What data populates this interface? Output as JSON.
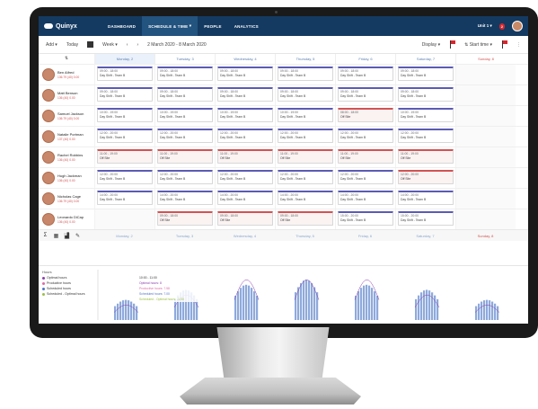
{
  "brand": {
    "name": "Quinyx"
  },
  "nav": [
    {
      "label": "DASHBOARD",
      "active": false
    },
    {
      "label": "SCHEDULE & TIME",
      "active": true
    },
    {
      "label": "PEOPLE",
      "active": false
    },
    {
      "label": "ANALYTICS",
      "active": false
    }
  ],
  "topbar": {
    "unit": "Unit 1",
    "notifications": "2"
  },
  "toolbar": {
    "add": "Add",
    "today": "Today",
    "period": "Week",
    "date_range": "2 March 2020 - 8 March 2020",
    "display": "Display",
    "flag_count": "2",
    "sort": "Start time",
    "alerts": "15"
  },
  "days": [
    {
      "label": "Monday, 2",
      "today": true,
      "sunday": false
    },
    {
      "label": "Tuesday, 3",
      "today": false,
      "sunday": false
    },
    {
      "label": "Wednesday, 4",
      "today": false,
      "sunday": false
    },
    {
      "label": "Thursday, 5",
      "today": false,
      "sunday": false
    },
    {
      "label": "Friday, 6",
      "today": false,
      "sunday": false
    },
    {
      "label": "Saturday, 7",
      "today": false,
      "sunday": false
    },
    {
      "label": "Sunday, 8",
      "today": false,
      "sunday": true
    }
  ],
  "employees": [
    {
      "name": "Ben Alfred",
      "hours": "136.79 (40) 0.00",
      "shifts": [
        [
          "09:00 - 18:00",
          "Day Shift - Team B"
        ],
        [
          "09:00 - 18:00",
          "Day Shift - Team B"
        ],
        [
          "09:00 - 18:00",
          "Day Shift - Team B"
        ],
        [
          "09:00 - 18:00",
          "Day Shift - Team B"
        ],
        [
          "09:00 - 18:00",
          "Day Shift - Team B"
        ],
        [
          "09:00 - 18:00",
          "Day Shift - Team B"
        ],
        null
      ]
    },
    {
      "name": "Matt Benson",
      "hours": "136 (40) 0.00",
      "shifts": [
        [
          "09:00 - 18:00",
          "Day Shift - Team B"
        ],
        [
          "09:00 - 18:00",
          "Day Shift - Team B"
        ],
        [
          "09:00 - 18:00",
          "Day Shift - Team B"
        ],
        [
          "09:00 - 18:00",
          "Day Shift - Team B"
        ],
        [
          "09:00 - 18:00",
          "Day Shift - Team B"
        ],
        [
          "09:00 - 18:00",
          "Day Shift - Team B"
        ],
        null
      ]
    },
    {
      "name": "Samuel Jackson",
      "hours": "136.79 (40) 0.00",
      "shifts": [
        [
          "10:00 - 19:00",
          "Day Shift - Team B"
        ],
        [
          "10:00 - 19:00",
          "Day Shift - Team B"
        ],
        [
          "10:00 - 19:00",
          "Day Shift - Team B"
        ],
        [
          "10:00 - 19:00",
          "Day Shift - Team B"
        ],
        [
          "08:00 - 18:00",
          "Off Site",
          "off"
        ],
        [
          "10:00 - 19:00",
          "Day Shift - Team B"
        ],
        null
      ]
    },
    {
      "name": "Natalie Portman",
      "hours": "137 (40) 0.00",
      "shifts": [
        [
          "12:00 - 20:00",
          "Day Shift - Team B"
        ],
        [
          "12:00 - 20:00",
          "Day Shift - Team B"
        ],
        [
          "12:00 - 20:00",
          "Day Shift - Team B"
        ],
        [
          "12:00 - 20:00",
          "Day Shift - Team B"
        ],
        [
          "12:00 - 20:00",
          "Day Shift - Team B"
        ],
        [
          "12:00 - 20:00",
          "Day Shift - Team B"
        ],
        null
      ]
    },
    {
      "name": "Rachel Robbins",
      "hours": "136 (40) 0.00",
      "shifts": [
        [
          "11:00 - 19:00",
          "Off Site",
          "off"
        ],
        [
          "11:00 - 19:00",
          "Off Site",
          "off"
        ],
        [
          "11:00 - 19:00",
          "Off Site",
          "off"
        ],
        [
          "11:00 - 19:00",
          "Off Site",
          "off"
        ],
        [
          "11:00 - 19:00",
          "Off Site",
          "off"
        ],
        [
          "11:00 - 19:00",
          "Off Site",
          "off"
        ],
        null
      ]
    },
    {
      "name": "Hugh Jackman",
      "hours": "136 (40) 0.00",
      "shifts": [
        [
          "12:00 - 20:00",
          "Day Shift - Team B"
        ],
        [
          "12:00 - 20:00",
          "Day Shift - Team B"
        ],
        [
          "12:00 - 20:00",
          "Day Shift - Team B"
        ],
        [
          "12:00 - 20:00",
          "Day Shift - Team B"
        ],
        [
          "12:00 - 20:00",
          "Day Shift - Team B"
        ],
        [
          "12:00 - 20:00",
          "Off Site",
          "off"
        ],
        null
      ]
    },
    {
      "name": "Nicholas Cage",
      "hours": "136.79 (40) 0.00",
      "shifts": [
        [
          "14:00 - 20:00",
          "Day Shift - Team B"
        ],
        [
          "14:00 - 20:00",
          "Day Shift - Team B"
        ],
        [
          "14:00 - 20:00",
          "Day Shift - Team B"
        ],
        [
          "14:00 - 20:00",
          "Day Shift - Team B"
        ],
        [
          "14:00 - 20:00",
          "Day Shift - Team B"
        ],
        [
          "14:00 - 20:00",
          "Day Shift - Team B"
        ],
        null
      ]
    },
    {
      "name": "Leonardo DiCap",
      "hours": "136 (40) 0.00",
      "shifts": [
        null,
        [
          "09:00 - 18:00",
          "Off Site",
          "off"
        ],
        [
          "09:00 - 18:00",
          "Off Site",
          "off"
        ],
        [
          "09:00 - 18:00",
          "Off Site",
          "off"
        ],
        [
          "15:00 - 20:00",
          "Day Shift - Team B"
        ],
        [
          "15:00 - 20:00",
          "Day Shift - Team B"
        ],
        null
      ]
    }
  ],
  "summary_days": [
    "Monday, 2",
    "Tuesday, 3",
    "Wednesday, 4",
    "Thursday, 5",
    "Friday, 6",
    "Saturday, 7",
    "Sunday, 8"
  ],
  "legend": {
    "title": "Hours",
    "items": [
      {
        "label": "Optimal hours",
        "color": "#8b3fae"
      },
      {
        "label": "Productive hours",
        "color": "#e06aa8"
      },
      {
        "label": "Scheduled hours",
        "color": "#4f73c8"
      },
      {
        "label": "Scheduled - Optimal hours",
        "color": "#9bbf45"
      }
    ]
  },
  "tooltip": {
    "time": "10:00 - 11:00",
    "lines": [
      {
        "text": "Optimal hours: 8",
        "color": "#8b3fae"
      },
      {
        "text": "Productive hours: 7.58",
        "color": "#e06aa8"
      },
      {
        "text": "Scheduled hours: 7.00",
        "color": "#4f73c8"
      },
      {
        "text": "Scheduled - Optimal hours: -1.00",
        "color": "#9bbf45"
      }
    ]
  },
  "chart_data": {
    "type": "bar",
    "series": [
      {
        "name": "Scheduled hours",
        "values": [
          4,
          6,
          7,
          8,
          7,
          6,
          4
        ]
      },
      {
        "name": "Optimal hours",
        "values": [
          3,
          5,
          8,
          8,
          8,
          5,
          3
        ]
      }
    ],
    "ylim": [
      0,
      10
    ],
    "groups": 7
  },
  "colors": {
    "topbar": "#143a61",
    "accent": "#5b5bb5",
    "off": "#d25353",
    "bar": "#8ea9dc"
  }
}
